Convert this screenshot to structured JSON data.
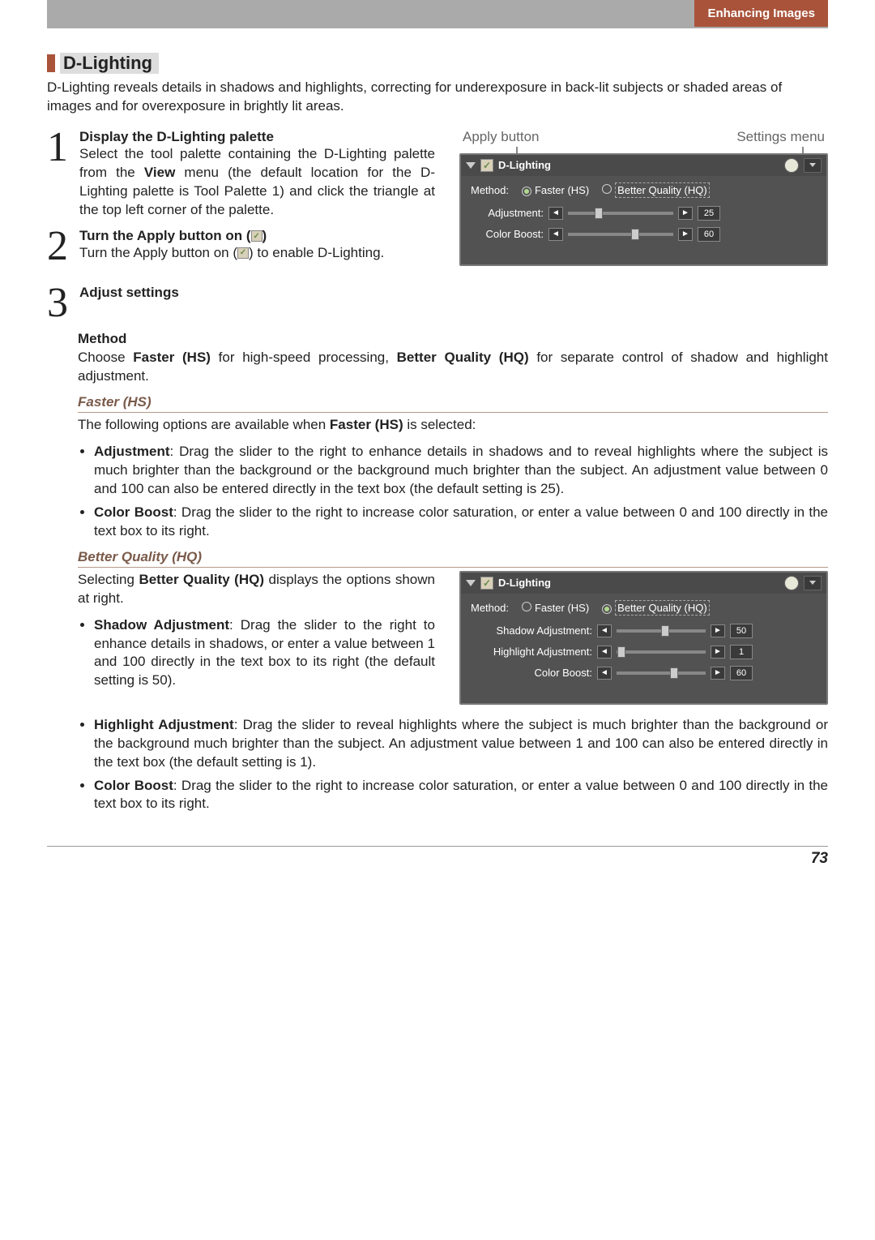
{
  "header": {
    "section": "Enhancing Images"
  },
  "title": "D-Lighting",
  "intro": "D-Lighting reveals details in shadows and highlights, correcting for underexposure in back-lit subjects or shaded areas of images and for overexposure in brightly lit areas.",
  "labels": {
    "apply": "Apply button",
    "settings": "Settings menu"
  },
  "steps": {
    "s1": {
      "n": "1",
      "title": "Display the D-Lighting palette",
      "text_a": "Select the tool palette containing the D-Lighting palette from the ",
      "bold_a": "View",
      "text_b": " menu (the default location for the D-Lighting palette is Tool Palette 1) and click the triangle at the top left corner of the palette."
    },
    "s2": {
      "n": "2",
      "title_a": "Turn the Apply button on (",
      "title_b": ")",
      "text_a": "Turn the Apply button on (",
      "text_b": ") to enable D-Lighting."
    },
    "s3": {
      "n": "3",
      "title": "Adjust settings"
    }
  },
  "method": {
    "head": "Method",
    "text_a": "Choose ",
    "bold_a": "Faster (HS)",
    "text_b": " for high-speed processing, ",
    "bold_b": "Better Quality (HQ)",
    "text_c": " for separate control of shadow and highlight adjustment."
  },
  "hs": {
    "head": "Faster (HS)",
    "intro_a": "The following options are available when ",
    "intro_bold": "Faster (HS)",
    "intro_b": " is selected:",
    "adj_bold": "Adjustment",
    "adj_text": ": Drag the slider to the right to enhance details in shadows and to reveal highlights where the subject is much brighter than the background or the background much brighter than the subject. An adjustment value between 0 and 100 can also be entered directly in the text box (the default setting is 25).",
    "cb_bold": "Color Boost",
    "cb_text": ": Drag the slider to the right to increase color saturation, or enter a value between 0 and 100 directly in the text box to its right."
  },
  "hq": {
    "head": "Better Quality (HQ)",
    "intro_a": "Selecting ",
    "intro_bold": "Better Quality (HQ)",
    "intro_b": " displays the options shown at right.",
    "sa_bold": "Shadow Adjustment",
    "sa_text": ": Drag the slider to the right to enhance details in shadows, or enter a value between 1 and 100 directly in the text box to its right (the default setting is 50).",
    "ha_bold": "Highlight Adjustment",
    "ha_text": ": Drag the slider to reveal highlights where the subject is much brighter than the background or the background much brighter than the subject. An adjustment value between 1 and 100 can also be entered directly in the text box (the default setting is 1).",
    "cb_bold": "Color Boost",
    "cb_text": ": Drag the slider to the right to increase color saturation, or enter a value between 0 and 100 directly in the text box to its right."
  },
  "panel1": {
    "title": "D-Lighting",
    "method_label": "Method:",
    "opt_hs": "Faster (HS)",
    "opt_hq": "Better Quality (HQ)",
    "adjustment_label": "Adjustment:",
    "adjustment_value": "25",
    "colorboost_label": "Color Boost:",
    "colorboost_value": "60"
  },
  "panel2": {
    "title": "D-Lighting",
    "method_label": "Method:",
    "opt_hs": "Faster (HS)",
    "opt_hq": "Better Quality (HQ)",
    "shadow_label": "Shadow Adjustment:",
    "shadow_value": "50",
    "highlight_label": "Highlight Adjustment:",
    "highlight_value": "1",
    "colorboost_label": "Color Boost:",
    "colorboost_value": "60"
  },
  "page_number": "73"
}
